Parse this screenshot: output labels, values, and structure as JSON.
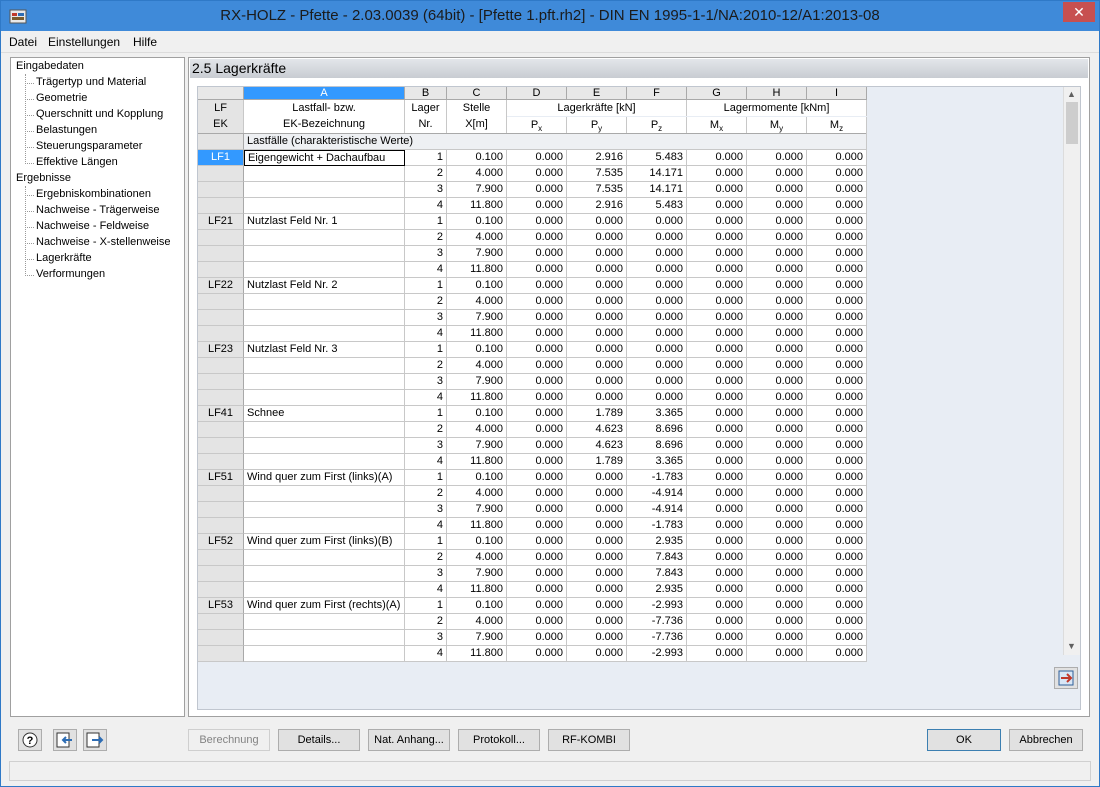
{
  "window": {
    "title": "RX-HOLZ - Pfette - 2.03.0039 (64bit) - [Pfette 1.pft.rh2] - DIN EN 1995-1-1/NA:2010-12/A1:2013-08",
    "close_symbol": "✕"
  },
  "menu": [
    "Datei",
    "Einstellungen",
    "Hilfe"
  ],
  "nav": {
    "groups": [
      {
        "label": "Eingabedaten",
        "items": [
          "Trägertyp und Material",
          "Geometrie",
          "Querschnitt und Kopplung",
          "Belastungen",
          "Steuerungsparameter",
          "Effektive Längen"
        ]
      },
      {
        "label": "Ergebnisse",
        "items": [
          "Ergebniskombinationen",
          "Nachweise - Trägerweise",
          "Nachweise - Feldweise",
          "Nachweise - X-stellenweise",
          "Lagerkräfte",
          "Verformungen"
        ]
      }
    ]
  },
  "panel": {
    "title": "2.5 Lagerkräfte",
    "columns": [
      "A",
      "B",
      "C",
      "D",
      "E",
      "F",
      "G",
      "H",
      "I"
    ],
    "headers": {
      "lf": "LF",
      "ek": "EK",
      "a1": "Lastfall- bzw.",
      "a2": "EK-Bezeichnung",
      "b1": "Lager",
      "b2": "Nr.",
      "c1": "Stelle",
      "c2": "X[m]",
      "forces": "Lagerkräfte [kN]",
      "moments": "Lagermomente [kNm]",
      "px": "Px",
      "py": "Py",
      "pz": "Pz",
      "mx": "Mx",
      "my": "My",
      "mz": "Mz"
    },
    "section_label": "Lastfälle (charakteristische Werte)",
    "loadcases": [
      {
        "id": "LF1",
        "name": "Eigengewicht + Dachaufbau",
        "rows": [
          [
            "1",
            "0.100",
            "0.000",
            "2.916",
            "5.483",
            "0.000",
            "0.000",
            "0.000"
          ],
          [
            "2",
            "4.000",
            "0.000",
            "7.535",
            "14.171",
            "0.000",
            "0.000",
            "0.000"
          ],
          [
            "3",
            "7.900",
            "0.000",
            "7.535",
            "14.171",
            "0.000",
            "0.000",
            "0.000"
          ],
          [
            "4",
            "11.800",
            "0.000",
            "2.916",
            "5.483",
            "0.000",
            "0.000",
            "0.000"
          ]
        ]
      },
      {
        "id": "LF21",
        "name": "Nutzlast Feld Nr. 1",
        "rows": [
          [
            "1",
            "0.100",
            "0.000",
            "0.000",
            "0.000",
            "0.000",
            "0.000",
            "0.000"
          ],
          [
            "2",
            "4.000",
            "0.000",
            "0.000",
            "0.000",
            "0.000",
            "0.000",
            "0.000"
          ],
          [
            "3",
            "7.900",
            "0.000",
            "0.000",
            "0.000",
            "0.000",
            "0.000",
            "0.000"
          ],
          [
            "4",
            "11.800",
            "0.000",
            "0.000",
            "0.000",
            "0.000",
            "0.000",
            "0.000"
          ]
        ]
      },
      {
        "id": "LF22",
        "name": "Nutzlast Feld Nr. 2",
        "rows": [
          [
            "1",
            "0.100",
            "0.000",
            "0.000",
            "0.000",
            "0.000",
            "0.000",
            "0.000"
          ],
          [
            "2",
            "4.000",
            "0.000",
            "0.000",
            "0.000",
            "0.000",
            "0.000",
            "0.000"
          ],
          [
            "3",
            "7.900",
            "0.000",
            "0.000",
            "0.000",
            "0.000",
            "0.000",
            "0.000"
          ],
          [
            "4",
            "11.800",
            "0.000",
            "0.000",
            "0.000",
            "0.000",
            "0.000",
            "0.000"
          ]
        ]
      },
      {
        "id": "LF23",
        "name": "Nutzlast Feld Nr. 3",
        "rows": [
          [
            "1",
            "0.100",
            "0.000",
            "0.000",
            "0.000",
            "0.000",
            "0.000",
            "0.000"
          ],
          [
            "2",
            "4.000",
            "0.000",
            "0.000",
            "0.000",
            "0.000",
            "0.000",
            "0.000"
          ],
          [
            "3",
            "7.900",
            "0.000",
            "0.000",
            "0.000",
            "0.000",
            "0.000",
            "0.000"
          ],
          [
            "4",
            "11.800",
            "0.000",
            "0.000",
            "0.000",
            "0.000",
            "0.000",
            "0.000"
          ]
        ]
      },
      {
        "id": "LF41",
        "name": "Schnee",
        "rows": [
          [
            "1",
            "0.100",
            "0.000",
            "1.789",
            "3.365",
            "0.000",
            "0.000",
            "0.000"
          ],
          [
            "2",
            "4.000",
            "0.000",
            "4.623",
            "8.696",
            "0.000",
            "0.000",
            "0.000"
          ],
          [
            "3",
            "7.900",
            "0.000",
            "4.623",
            "8.696",
            "0.000",
            "0.000",
            "0.000"
          ],
          [
            "4",
            "11.800",
            "0.000",
            "1.789",
            "3.365",
            "0.000",
            "0.000",
            "0.000"
          ]
        ]
      },
      {
        "id": "LF51",
        "name": "Wind quer zum First (links)(A)",
        "rows": [
          [
            "1",
            "0.100",
            "0.000",
            "0.000",
            "-1.783",
            "0.000",
            "0.000",
            "0.000"
          ],
          [
            "2",
            "4.000",
            "0.000",
            "0.000",
            "-4.914",
            "0.000",
            "0.000",
            "0.000"
          ],
          [
            "3",
            "7.900",
            "0.000",
            "0.000",
            "-4.914",
            "0.000",
            "0.000",
            "0.000"
          ],
          [
            "4",
            "11.800",
            "0.000",
            "0.000",
            "-1.783",
            "0.000",
            "0.000",
            "0.000"
          ]
        ]
      },
      {
        "id": "LF52",
        "name": "Wind quer zum First (links)(B)",
        "rows": [
          [
            "1",
            "0.100",
            "0.000",
            "0.000",
            "2.935",
            "0.000",
            "0.000",
            "0.000"
          ],
          [
            "2",
            "4.000",
            "0.000",
            "0.000",
            "7.843",
            "0.000",
            "0.000",
            "0.000"
          ],
          [
            "3",
            "7.900",
            "0.000",
            "0.000",
            "7.843",
            "0.000",
            "0.000",
            "0.000"
          ],
          [
            "4",
            "11.800",
            "0.000",
            "0.000",
            "2.935",
            "0.000",
            "0.000",
            "0.000"
          ]
        ]
      },
      {
        "id": "LF53",
        "name": "Wind quer zum First (rechts)(A)",
        "rows": [
          [
            "1",
            "0.100",
            "0.000",
            "0.000",
            "-2.993",
            "0.000",
            "0.000",
            "0.000"
          ],
          [
            "2",
            "4.000",
            "0.000",
            "0.000",
            "-7.736",
            "0.000",
            "0.000",
            "0.000"
          ],
          [
            "3",
            "7.900",
            "0.000",
            "0.000",
            "-7.736",
            "0.000",
            "0.000",
            "0.000"
          ],
          [
            "4",
            "11.800",
            "0.000",
            "0.000",
            "-2.993",
            "0.000",
            "0.000",
            "0.000"
          ]
        ]
      }
    ]
  },
  "buttons": {
    "berechnung": "Berechnung",
    "details": "Details...",
    "nat_anhang": "Nat. Anhang...",
    "protokoll": "Protokoll...",
    "rf_kombi": "RF-KOMBI",
    "ok": "OK",
    "abbrechen": "Abbrechen"
  },
  "icons": {
    "help": "help-icon",
    "export": "export-icon",
    "import": "import-icon",
    "table_export": "table-export-icon"
  }
}
